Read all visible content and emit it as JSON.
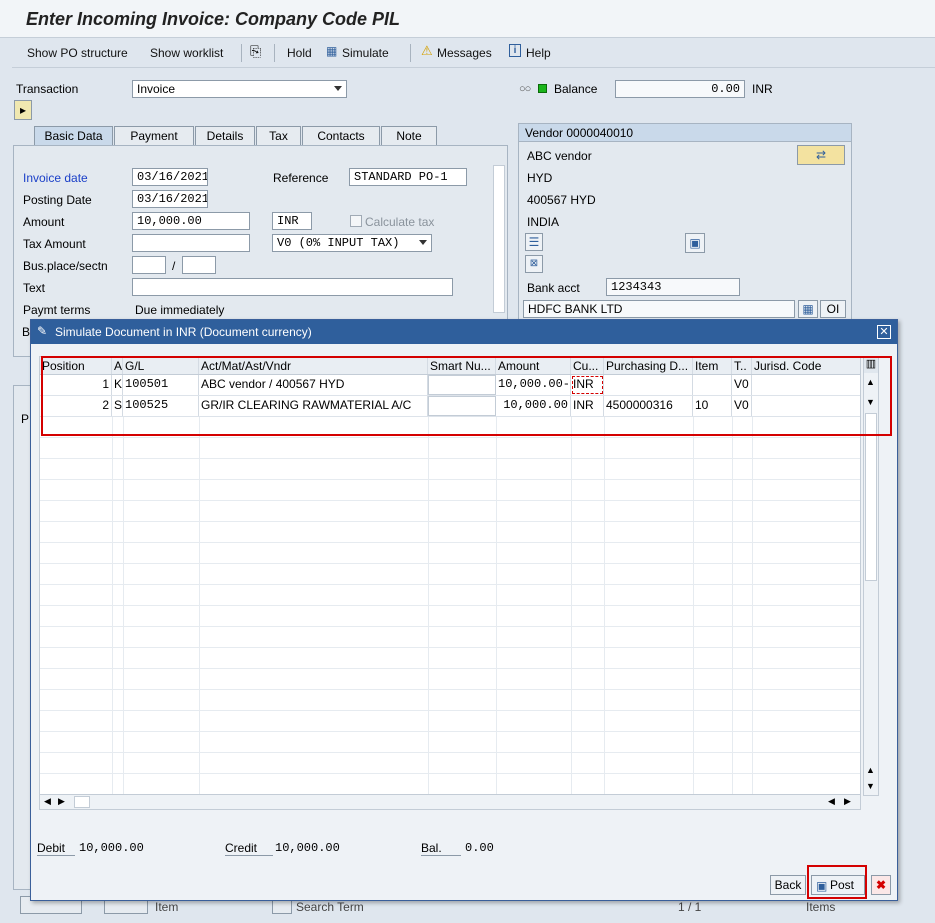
{
  "window": {
    "title": "Enter Incoming Invoice: Company Code PIL"
  },
  "toolbar": {
    "show_po": "Show PO structure",
    "show_worklist": "Show worklist",
    "hold": "Hold",
    "simulate": "Simulate",
    "messages": "Messages",
    "help": "Help"
  },
  "header": {
    "transaction_label": "Transaction",
    "transaction_value": "Invoice",
    "balance_label": "Balance",
    "balance_value": "0.00",
    "balance_currency": "INR"
  },
  "tabs": [
    "Basic Data",
    "Payment",
    "Details",
    "Tax",
    "Contacts",
    "Note"
  ],
  "basic_data": {
    "invoice_date_label": "Invoice date",
    "invoice_date": "03/16/2021",
    "posting_date_label": "Posting Date",
    "posting_date": "03/16/2021",
    "reference_label": "Reference",
    "reference": "STANDARD PO-1",
    "amount_label": "Amount",
    "amount": "10,000.00",
    "currency": "INR",
    "calculate_tax": "Calculate tax",
    "tax_amount_label": "Tax Amount",
    "tax_code": "V0 (0% INPUT TAX)",
    "bus_place_label": "Bus.place/sectn",
    "slash": "/",
    "text_label": "Text",
    "paymt_terms_label": "Paymt terms",
    "paymt_terms": "Due immediately",
    "b_letter": "B"
  },
  "vendor": {
    "title": "Vendor 0000040010",
    "name": "ABC vendor",
    "city": "HYD",
    "postal": "400567 HYD",
    "country": "INDIA",
    "bank_acct_label": "Bank acct",
    "bank_acct": "1234343",
    "bank_name": "HDFC BANK LTD",
    "oi": "OI"
  },
  "dialog": {
    "title": "Simulate Document in INR (Document currency)",
    "columns": [
      "Position",
      "A",
      "G/L",
      "Act/Mat/Ast/Vndr",
      "Smart Nu...",
      "Amount",
      "Cu...",
      "Purchasing D...",
      "Item",
      "T..",
      "Jurisd. Code"
    ],
    "rows": [
      {
        "position": "1",
        "a": "K",
        "gl": "100501",
        "account": "ABC vendor / 400567 HYD",
        "smart": "",
        "amount": "10,000.00-",
        "currency": "INR",
        "po": "",
        "item": "",
        "tax": "V0",
        "jurisd": ""
      },
      {
        "position": "2",
        "a": "S",
        "gl": "100525",
        "account": "GR/IR CLEARING RAWMATERIAL A/C",
        "smart": "",
        "amount": "10,000.00",
        "currency": "INR",
        "po": "4500000316",
        "item": "10",
        "tax": "V0",
        "jurisd": ""
      }
    ],
    "debit_label": "Debit",
    "debit": "10,000.00",
    "credit_label": "Credit",
    "credit": "10,000.00",
    "bal_label": "Bal.",
    "bal": "0.00",
    "back": "Back",
    "post": "Post"
  },
  "footer": {
    "item": "Item",
    "search_term": "Search Term",
    "page": "1 / 1",
    "items": "Items"
  },
  "colors": {
    "accent": "#2f5f9c",
    "highlight": "#d40000"
  }
}
